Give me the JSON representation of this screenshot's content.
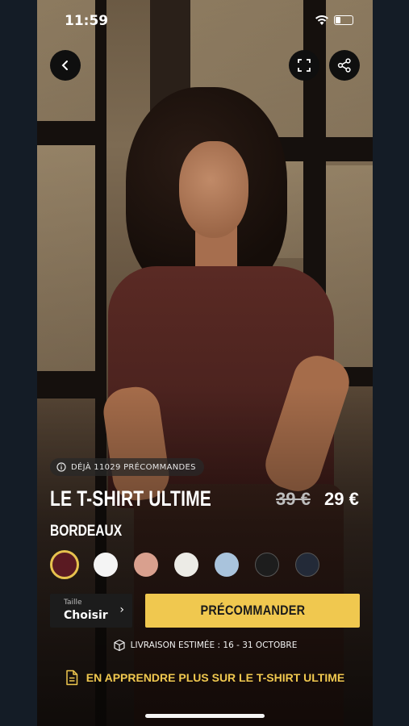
{
  "status_bar": {
    "time": "11:59"
  },
  "product": {
    "preorder_badge": "DÉJÀ 11029 PRÉCOMMANDES",
    "title": "LE T-SHIRT ULTIME",
    "old_price": "39 €",
    "price": "29 €",
    "color_name": "BORDEAUX",
    "swatches": [
      {
        "name": "bordeaux",
        "color": "#5a1a22",
        "selected": true
      },
      {
        "name": "white",
        "color": "#f4f4f4",
        "selected": false
      },
      {
        "name": "pink",
        "color": "#d9a08e",
        "selected": false
      },
      {
        "name": "off-white",
        "color": "#ecebe6",
        "selected": false
      },
      {
        "name": "light-blue",
        "color": "#a9c3dc",
        "selected": false
      },
      {
        "name": "black",
        "color": "#1d1d1d",
        "selected": false
      },
      {
        "name": "navy",
        "color": "#232a38",
        "selected": false
      }
    ]
  },
  "size_selector": {
    "label": "Taille",
    "value": "Choisir"
  },
  "cta": {
    "label": "PRÉCOMMANDER",
    "color": "#f0c84f"
  },
  "delivery": {
    "text": "LIVRAISON ESTIMÉE : 16 - 31 OCTOBRE"
  },
  "learn_more": {
    "text": "EN APPRENDRE PLUS SUR LE T-SHIRT ULTIME"
  },
  "icons": {
    "back": "back-arrow-icon",
    "fullscreen": "fullscreen-icon",
    "share": "share-icon"
  },
  "battery_level": 0.3
}
